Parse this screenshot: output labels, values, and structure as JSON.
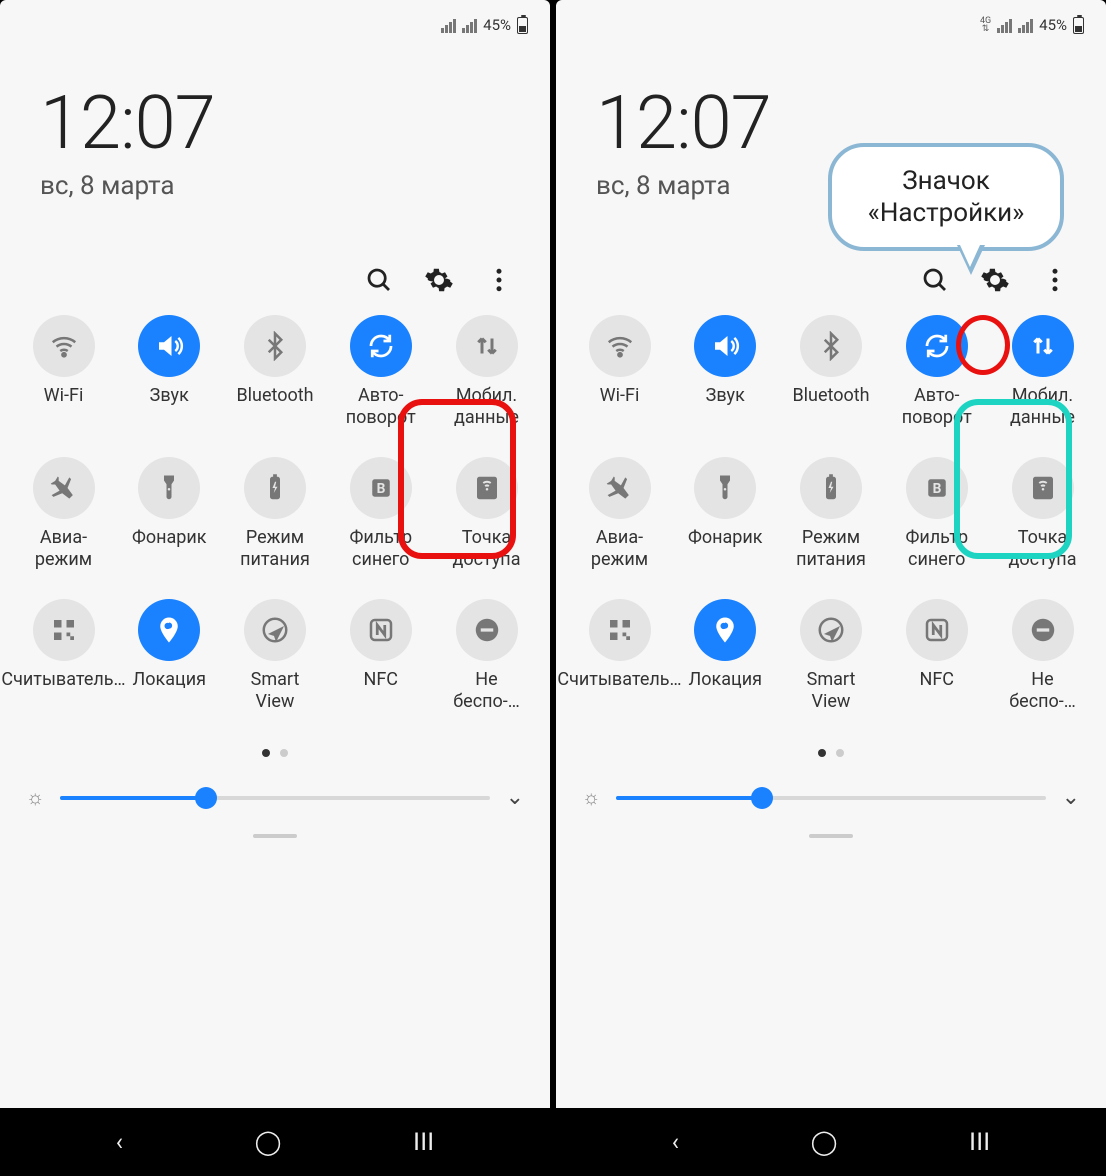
{
  "status": {
    "battery_pct": "45%",
    "lte_label": "4G"
  },
  "clock": {
    "time": "12:07",
    "date": "вс, 8 марта"
  },
  "callout": "Значок\n«Настройки»",
  "tiles": [
    {
      "icon": "wifi",
      "label": "Wi-Fi",
      "active": false
    },
    {
      "icon": "sound",
      "label": "Звук",
      "active": true
    },
    {
      "icon": "bluetooth",
      "label": "Bluetooth",
      "active": false
    },
    {
      "icon": "rotate",
      "label": "Авто-\nповорот",
      "active": true
    },
    {
      "icon": "data",
      "label": "Мобил.\nданные",
      "active": false
    },
    {
      "icon": "airplane",
      "label": "Авиа-\nрежим",
      "active": false
    },
    {
      "icon": "torch",
      "label": "Фонарик",
      "active": false
    },
    {
      "icon": "power",
      "label": "Режим\nпитания",
      "active": false
    },
    {
      "icon": "bluefilter",
      "label": "Фильтр\nсинего",
      "active": false
    },
    {
      "icon": "hotspot",
      "label": "Точка\nдоступа",
      "active": false
    },
    {
      "icon": "qr",
      "label": "Считыватель…",
      "active": false
    },
    {
      "icon": "location",
      "label": "Локация",
      "active": true
    },
    {
      "icon": "smartview",
      "label": "Smart\nView",
      "active": false
    },
    {
      "icon": "nfc",
      "label": "NFC",
      "active": false
    },
    {
      "icon": "dnd",
      "label": "Не\nбеспо-…",
      "active": false
    }
  ],
  "right_overrides": {
    "data_active": true
  }
}
